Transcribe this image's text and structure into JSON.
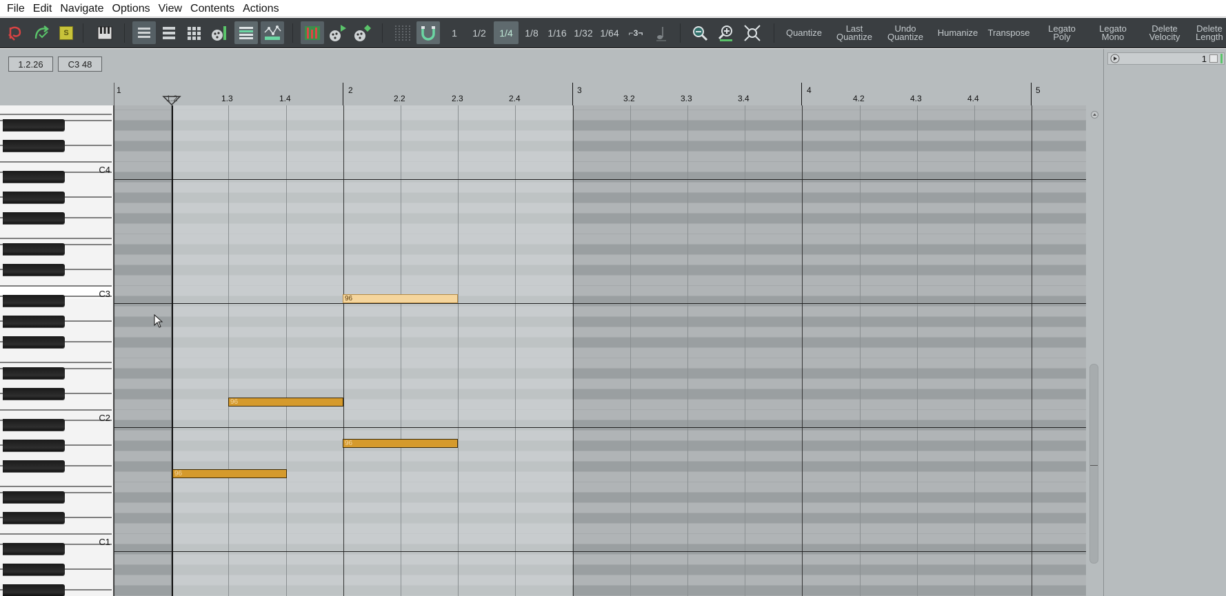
{
  "menu": [
    "File",
    "Edit",
    "Navigate",
    "Options",
    "View",
    "Contents",
    "Actions"
  ],
  "toolbar": {
    "grid_values": [
      "1",
      "1/2",
      "1/4",
      "1/8",
      "1/16",
      "1/32",
      "1/64"
    ],
    "active_grid": "1/4",
    "triplet_label": "⌐3¬",
    "actions": [
      {
        "label": "Quantize"
      },
      {
        "label": "Last\nQuantize"
      },
      {
        "label": "Undo\nQuantize"
      },
      {
        "label": "Humanize"
      },
      {
        "label": "Transpose"
      },
      {
        "label": "Legato\nPoly"
      },
      {
        "label": "Legato\nMono"
      },
      {
        "label": "Delete\nVelocity"
      },
      {
        "label": "Delete\nLength"
      }
    ]
  },
  "status": {
    "position": "1.2.26",
    "pitch": "C3  48"
  },
  "ruler": {
    "labels": [
      "1",
      "1.2",
      "1.3",
      "1.4",
      "2",
      "2.2",
      "2.3",
      "2.4",
      "3",
      "3.2",
      "3.3",
      "3.4",
      "4",
      "4.2",
      "4.3",
      "4.4",
      "5"
    ]
  },
  "keyboard": {
    "labels": [
      "C4",
      "C3",
      "C2",
      "C1"
    ]
  },
  "notes": [
    {
      "velocity": "96",
      "pitch": "C3",
      "start": "2",
      "end": "2.3",
      "selected": true
    },
    {
      "velocity": "96",
      "pitch": "D#2",
      "start": "1.3",
      "end": "2",
      "selected": false
    },
    {
      "velocity": "96",
      "pitch": "B1",
      "start": "2",
      "end": "2.3",
      "selected": false
    },
    {
      "velocity": "96",
      "pitch": "G#1",
      "start": "1.2",
      "end": "1.4",
      "selected": false
    }
  ],
  "rightpanel": {
    "lane_value": "1"
  },
  "colors": {
    "note": "#d59a2c",
    "note_selected": "#f5d59c",
    "toolbar": "#3a3e41",
    "grid": "#a5a9ab"
  }
}
